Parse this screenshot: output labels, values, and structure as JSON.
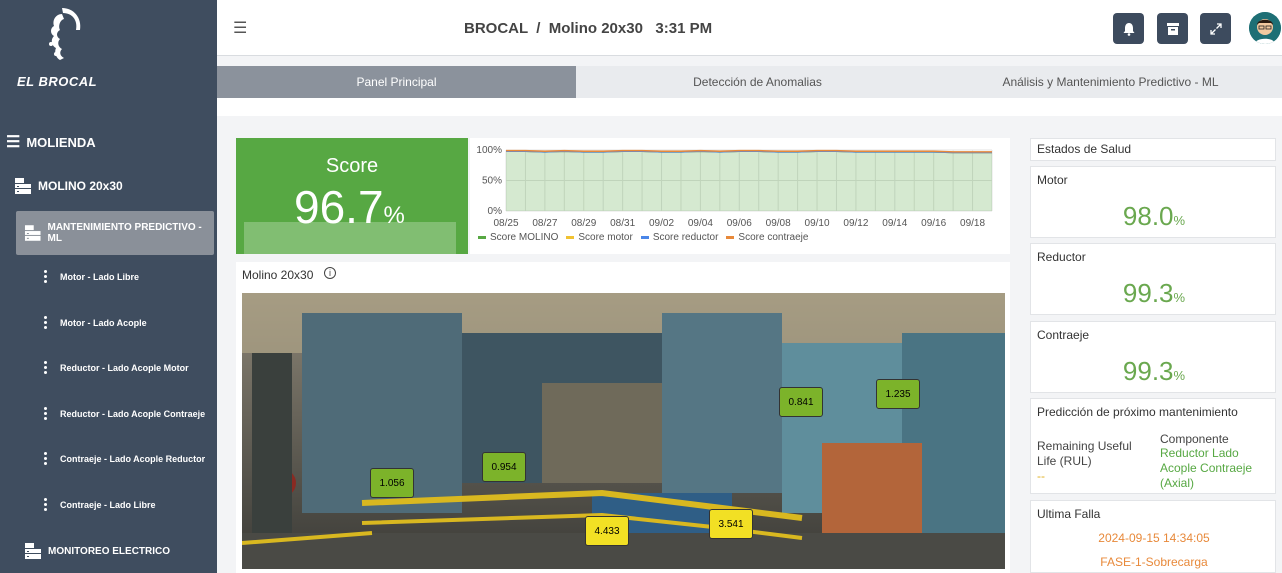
{
  "brand": {
    "name": "EL BROCAL"
  },
  "sidebar": {
    "section": "MOLIENDA",
    "mill": "MOLINO 20x30",
    "active": "MANTENIMIENTO PREDICTIVO - ML",
    "subitems": [
      "Motor - Lado Libre",
      "Motor - Lado Acople",
      "Reductor - Lado Acople Motor",
      "Reductor - Lado Acople Contraeje",
      "Contraeje - Lado Acople Reductor",
      "Contraeje - Lado Libre"
    ],
    "monitor": "MONITOREO ELECTRICO"
  },
  "header": {
    "title": "BROCAL  /  Molino 20x30   3:31 PM"
  },
  "toolbar": {
    "icons": [
      "bell-icon",
      "archive-icon",
      "expand-icon",
      "avatar"
    ]
  },
  "tabs": [
    "Panel Principal",
    "Detección de Anomalias",
    "Análisis y Mantenimiento Predictivo - ML"
  ],
  "score": {
    "label": "Score",
    "value": "96.7",
    "unit": "%"
  },
  "chart_data": {
    "type": "line",
    "x": [
      "08/25",
      "08/26",
      "08/27",
      "08/28",
      "08/29",
      "08/30",
      "08/31",
      "09/01",
      "09/02",
      "09/03",
      "09/04",
      "09/05",
      "09/06",
      "09/07",
      "09/08",
      "09/09",
      "09/10",
      "09/11",
      "09/12",
      "09/13",
      "09/14",
      "09/15",
      "09/16",
      "09/17",
      "09/18",
      "09/19"
    ],
    "x_ticks": [
      "08/25",
      "08/27",
      "08/29",
      "08/31",
      "09/02",
      "09/04",
      "09/06",
      "09/08",
      "09/10",
      "09/12",
      "09/14",
      "09/16",
      "09/18"
    ],
    "series": [
      {
        "name": "Score MOLINO",
        "color": "#57a843",
        "values": [
          98,
          98,
          97,
          98,
          97,
          97,
          98,
          98,
          97,
          97,
          98,
          97,
          98,
          98,
          97,
          97,
          98,
          98,
          97,
          97,
          97,
          97,
          97,
          96,
          96,
          96
        ]
      },
      {
        "name": "Score motor",
        "color": "#f1c232",
        "values": [
          98,
          98,
          97,
          98,
          97,
          97,
          98,
          98,
          97,
          97,
          98,
          97,
          98,
          98,
          97,
          97,
          98,
          98,
          97,
          97,
          97,
          97,
          97,
          96,
          96,
          96
        ]
      },
      {
        "name": "Score reductor",
        "color": "#4a86e8",
        "values": [
          98,
          98,
          97,
          98,
          97,
          97,
          98,
          98,
          97,
          97,
          98,
          97,
          98,
          98,
          97,
          97,
          98,
          98,
          97,
          97,
          97,
          97,
          97,
          96,
          96,
          96
        ]
      },
      {
        "name": "Score contraeje",
        "color": "#e8893a",
        "values": [
          99,
          99,
          98,
          99,
          98,
          98,
          99,
          99,
          98,
          98,
          99,
          98,
          99,
          99,
          98,
          98,
          99,
          99,
          98,
          98,
          98,
          98,
          98,
          97,
          97,
          97
        ]
      }
    ],
    "yticks": [
      "100%",
      "50%",
      "0%"
    ],
    "ylim": [
      0,
      100
    ],
    "grid": true,
    "legend": "bottom"
  },
  "photo": {
    "title": "Molino 20x30",
    "sensors": [
      {
        "value": "1.056",
        "color": "#7cb32a"
      },
      {
        "value": "0.954",
        "color": "#7cb32a"
      },
      {
        "value": "4.433",
        "color": "#f2e024"
      },
      {
        "value": "3.541",
        "color": "#f2e024"
      },
      {
        "value": "0.841",
        "color": "#7cb32a"
      },
      {
        "value": "1.235",
        "color": "#7cb32a"
      }
    ]
  },
  "health": {
    "title": "Estados de Salud",
    "items": [
      {
        "label": "Motor",
        "value": "98.0",
        "unit": "%"
      },
      {
        "label": "Reductor",
        "value": "99.3",
        "unit": "%"
      },
      {
        "label": "Contraeje",
        "value": "99.3",
        "unit": "%"
      }
    ]
  },
  "prediction": {
    "title": "Predicción de próximo mantenimiento",
    "rul_label": "Remaining Useful Life (RUL)",
    "rul_value": "--",
    "comp_label": "Componente",
    "comp_value": "Reductor Lado Acople Contraeje (Axial)"
  },
  "last_failure": {
    "title": "Ultima Falla",
    "date": "2024-09-15 14:34:05",
    "type": "FASE-1-Sobrecarga"
  }
}
